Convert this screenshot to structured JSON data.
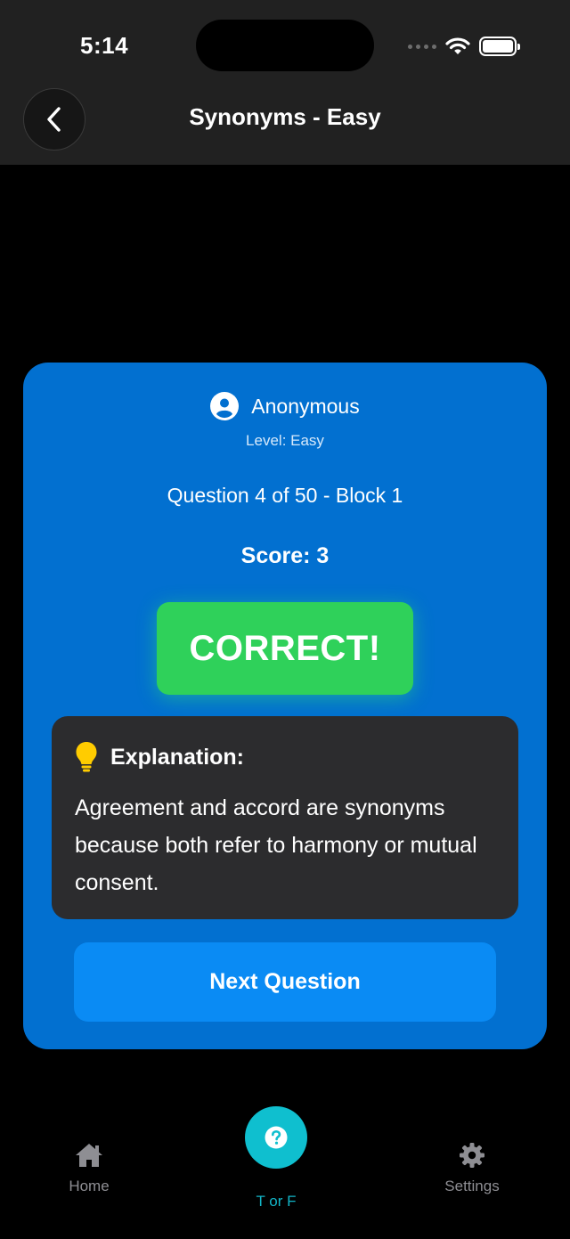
{
  "status_bar": {
    "time": "5:14"
  },
  "nav": {
    "title": "Synonyms - Easy"
  },
  "card": {
    "user_name": "Anonymous",
    "level": "Level: Easy",
    "question": "Question 4 of 50 - Block 1",
    "score": "Score: 3",
    "result": "CORRECT!",
    "explanation_label": "Explanation:",
    "explanation_text": "Agreement and accord are synonyms because both refer to harmony or mutual consent.",
    "next_button": "Next Question"
  },
  "tabs": [
    {
      "label": "Home",
      "icon": "home-icon"
    },
    {
      "label": "T or F",
      "icon": "question-icon",
      "active": true
    },
    {
      "label": "Settings",
      "icon": "gear-icon"
    }
  ],
  "colors": {
    "card_bg": "#0270d0",
    "correct_bg": "#2fd15a",
    "explanation_bg": "#2c2c2e",
    "next_button_bg": "#0a8bf4",
    "active_tab": "#0fbfcf"
  }
}
